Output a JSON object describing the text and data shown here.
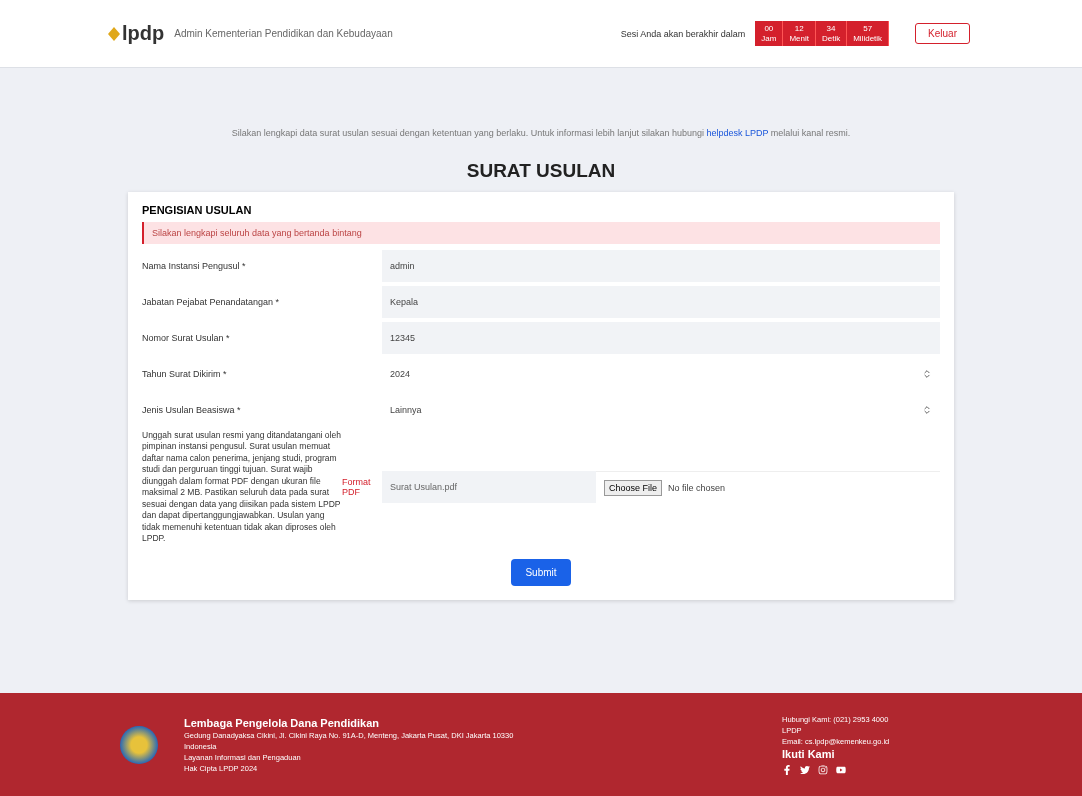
{
  "header": {
    "logo": "lpdp",
    "user": "Admin Kementerian Pendidikan dan Kebudayaan",
    "session_label": "Sesi Anda akan berakhir dalam",
    "countdown": [
      {
        "value": "00",
        "unit": "Jam"
      },
      {
        "value": "12",
        "unit": "Menit"
      },
      {
        "value": "34",
        "unit": "Detik"
      },
      {
        "value": "57",
        "unit": "Milidetik"
      }
    ],
    "logout": "Keluar"
  },
  "notice": {
    "text": "Silakan lengkapi data surat usulan sesuai dengan ketentuan yang berlaku. Untuk informasi lebih lanjut silakan hubungi",
    "link": "helpdesk LPDP",
    "after": "melalui kanal resmi."
  },
  "page_title": "SURAT USULAN",
  "section_title": "PENGISIAN USULAN",
  "alert": "Silakan lengkapi seluruh data yang bertanda bintang",
  "fields": [
    {
      "kind": "text",
      "label": "Nama Instansi Pengusul *",
      "value": "admin"
    },
    {
      "kind": "text",
      "label": "Jabatan Pejabat Penandatangan *",
      "value": "Kepala"
    },
    {
      "kind": "text",
      "label": "Nomor Surat Usulan *",
      "value": "12345"
    },
    {
      "kind": "select",
      "label": "Tahun Surat Dikirim *",
      "value": "2024"
    },
    {
      "kind": "select",
      "label": "Jenis Usulan Beasiswa *",
      "value": "Lainnya"
    }
  ],
  "upload": {
    "label": "Unggah surat usulan resmi yang ditandatangani oleh pimpinan instansi pengusul. Surat usulan memuat daftar nama calon penerima, jenjang studi, program studi dan perguruan tinggi tujuan. Surat wajib diunggah dalam format PDF dengan ukuran file maksimal 2 MB. Pastikan seluruh data pada surat sesuai dengan data yang diisikan pada sistem LPDP dan dapat dipertanggungjawabkan. Usulan yang tidak memenuhi ketentuan tidak akan diproses oleh LPDP.",
    "hint": "Format PDF",
    "file_name": "Surat Usulan.pdf",
    "chooser": "Choose File",
    "no_file": "No file chosen"
  },
  "submit": "Submit",
  "footer": {
    "title": "Lembaga Pengelola Dana Pendidikan",
    "lines": [
      "Gedung Danadyaksa Cikini, Jl. Cikini Raya No. 91A-D, Menteng, Jakarta Pusat, DKI Jakarta 10330",
      "Indonesia",
      "Layanan Informasi dan Pengaduan",
      "Hak Cipta LPDP 2024"
    ],
    "contact": [
      "Hubungi Kami: (021) 2953 4000",
      "LPDP",
      "Email: cs.lpdp@kemenkeu.go.id"
    ],
    "follow": "Ikuti Kami"
  }
}
